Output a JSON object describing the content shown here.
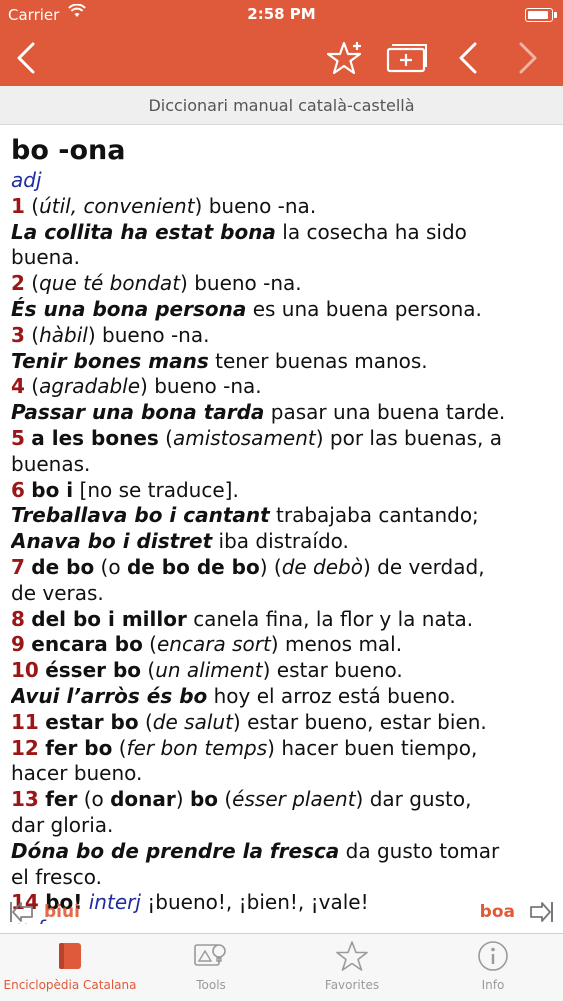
{
  "status": {
    "carrier": "Carrier",
    "time": "2:58 PM"
  },
  "subtitle": "Diccionari manual català-castellà",
  "entry": {
    "headword": "bo -ona",
    "pos": "adj",
    "s1": {
      "num": "1",
      "paren": "útil, convenient",
      "trans": "bueno -na."
    },
    "e1": {
      "ex": "La collita ha estat bona",
      "tr": "la cosecha ha sido",
      "tr2": "buena."
    },
    "s2": {
      "num": "2",
      "paren": "que té bondat",
      "trans": "bueno -na."
    },
    "e2": {
      "ex": "És una bona persona",
      "tr": "es una buena persona."
    },
    "s3": {
      "num": "3",
      "paren": "hàbil",
      "trans": "bueno -na."
    },
    "e3": {
      "ex": "Tenir bones mans",
      "tr": "tener buenas manos."
    },
    "s4": {
      "num": "4",
      "paren": "agradable",
      "trans": "bueno -na."
    },
    "e4": {
      "ex": "Passar una bona tarda",
      "tr": "pasar una buena tarde."
    },
    "s5": {
      "num": "5",
      "phrase": "a les bones",
      "paren": "amistosament",
      "trans": "por las buenas, a",
      "trans2": "buenas."
    },
    "s6": {
      "num": "6",
      "phrase": "bo i",
      "trans": "[no se traduce]."
    },
    "e6a": {
      "ex": "Treballava bo i cantant",
      "tr": "trabajaba cantando;"
    },
    "e6b": {
      "ex": "Anava bo i distret",
      "tr": "iba distraído."
    },
    "s7": {
      "num": "7",
      "phrase": "de bo",
      "o": "(o",
      "phrase2": "de bo de bo",
      "close": ")",
      "paren": "de debò",
      "trans": "de verdad,",
      "trans2": "de veras."
    },
    "s8": {
      "num": "8",
      "phrase": "del bo i millor",
      "trans": "canela fina, la flor y la nata."
    },
    "s9": {
      "num": "9",
      "phrase": "encara bo",
      "paren": "encara sort",
      "trans": "menos mal."
    },
    "s10": {
      "num": "10",
      "phrase": "ésser bo",
      "paren": "un aliment",
      "trans": "estar bueno."
    },
    "e10": {
      "ex": "Avui l’arròs és bo",
      "tr": "hoy el arroz está bueno."
    },
    "s11": {
      "num": "11",
      "phrase": "estar bo",
      "paren": "de salut",
      "trans": "estar bueno, estar bien."
    },
    "s12": {
      "num": "12",
      "phrase": "fer bo",
      "paren": "fer bon temps",
      "trans": "hacer buen tiempo,",
      "trans2": "hacer bueno."
    },
    "s13": {
      "num": "13",
      "phrase": "fer",
      "o": "(o",
      "phrase2": "donar",
      "close": ")",
      "phrase3": "bo",
      "paren": "ésser plaent",
      "trans": "dar gusto,",
      "trans2": "dar gloria."
    },
    "e13": {
      "ex": "Dóna bo de prendre la fresca",
      "tr": "da gusto tomar",
      "tr2": "el fresco."
    },
    "s14": {
      "num": "14",
      "phrase": "bo!",
      "pos": "interj",
      "trans": "¡bueno!, ¡bien!, ¡vale!"
    },
    "next_pos": "m f"
  },
  "word_nav": {
    "prev": "biui",
    "next": "boa"
  },
  "tabs": [
    {
      "label": "Enciclopèdia Catalana",
      "icon": "book-icon"
    },
    {
      "label": "Tools",
      "icon": "tools-icon"
    },
    {
      "label": "Favorites",
      "icon": "star-icon"
    },
    {
      "label": "Info",
      "icon": "info-icon"
    }
  ],
  "colors": {
    "accent": "#de5a3a",
    "sense_number": "#9b1616",
    "pos": "#1e2ca0"
  }
}
